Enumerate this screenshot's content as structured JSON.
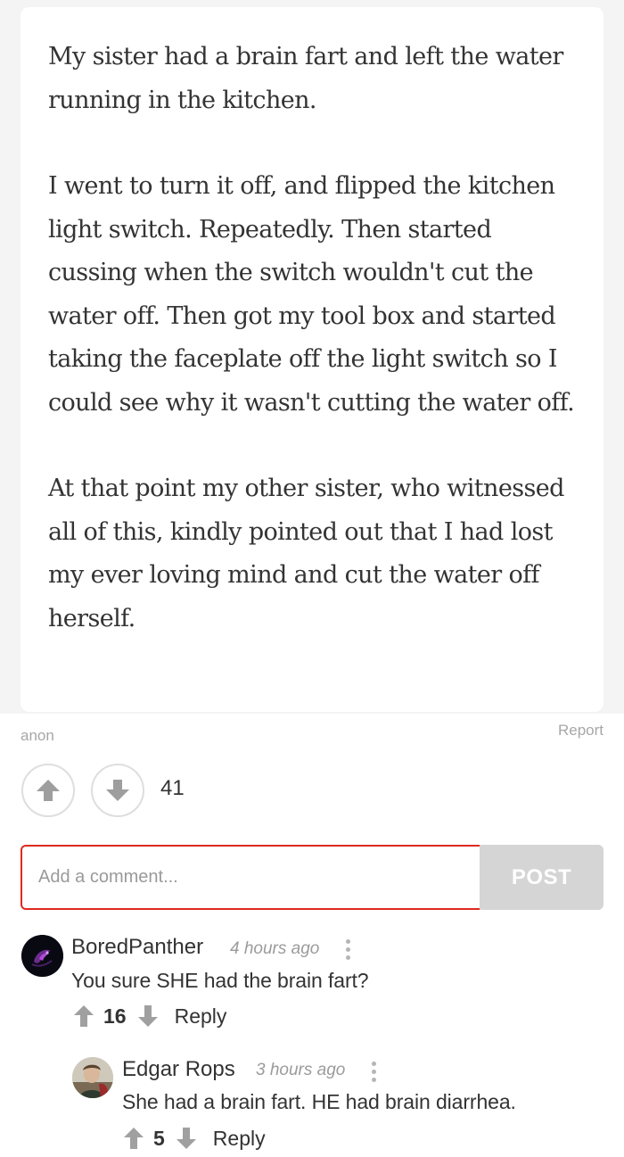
{
  "post": {
    "paragraphs": [
      "My sister had a brain fart and left the water running in the kitchen.",
      "I went to turn it off, and flipped the kitchen light switch. Repeatedly. Then started cussing when the switch wouldn't cut the water off. Then got my tool box and started taking the faceplate off the light switch so I could see why it wasn't cutting the water off.",
      "At that point my other sister, who witnessed all of this, kindly pointed out that I had lost my ever loving mind and cut the water off herself."
    ],
    "author": "anon",
    "report_label": "Report",
    "vote_count": "41"
  },
  "comment_form": {
    "placeholder": "Add a comment...",
    "post_label": "POST"
  },
  "comments": [
    {
      "name": "BoredPanther",
      "time": "4 hours ago",
      "text": "You sure SHE had the brain fart?",
      "votes": "16",
      "reply_label": "Reply"
    },
    {
      "name": "Edgar Rops",
      "time": "3 hours ago",
      "text": "She had a brain fart. HE had brain diarrhea.",
      "votes": "5",
      "reply_label": "Reply"
    }
  ],
  "colors": {
    "accent": "#e02a20",
    "muted": "#a7a7a7",
    "button_disabled": "#d5d5d5"
  },
  "icons": [
    "arrow-up-icon",
    "arrow-down-icon",
    "more-vertical-icon"
  ]
}
